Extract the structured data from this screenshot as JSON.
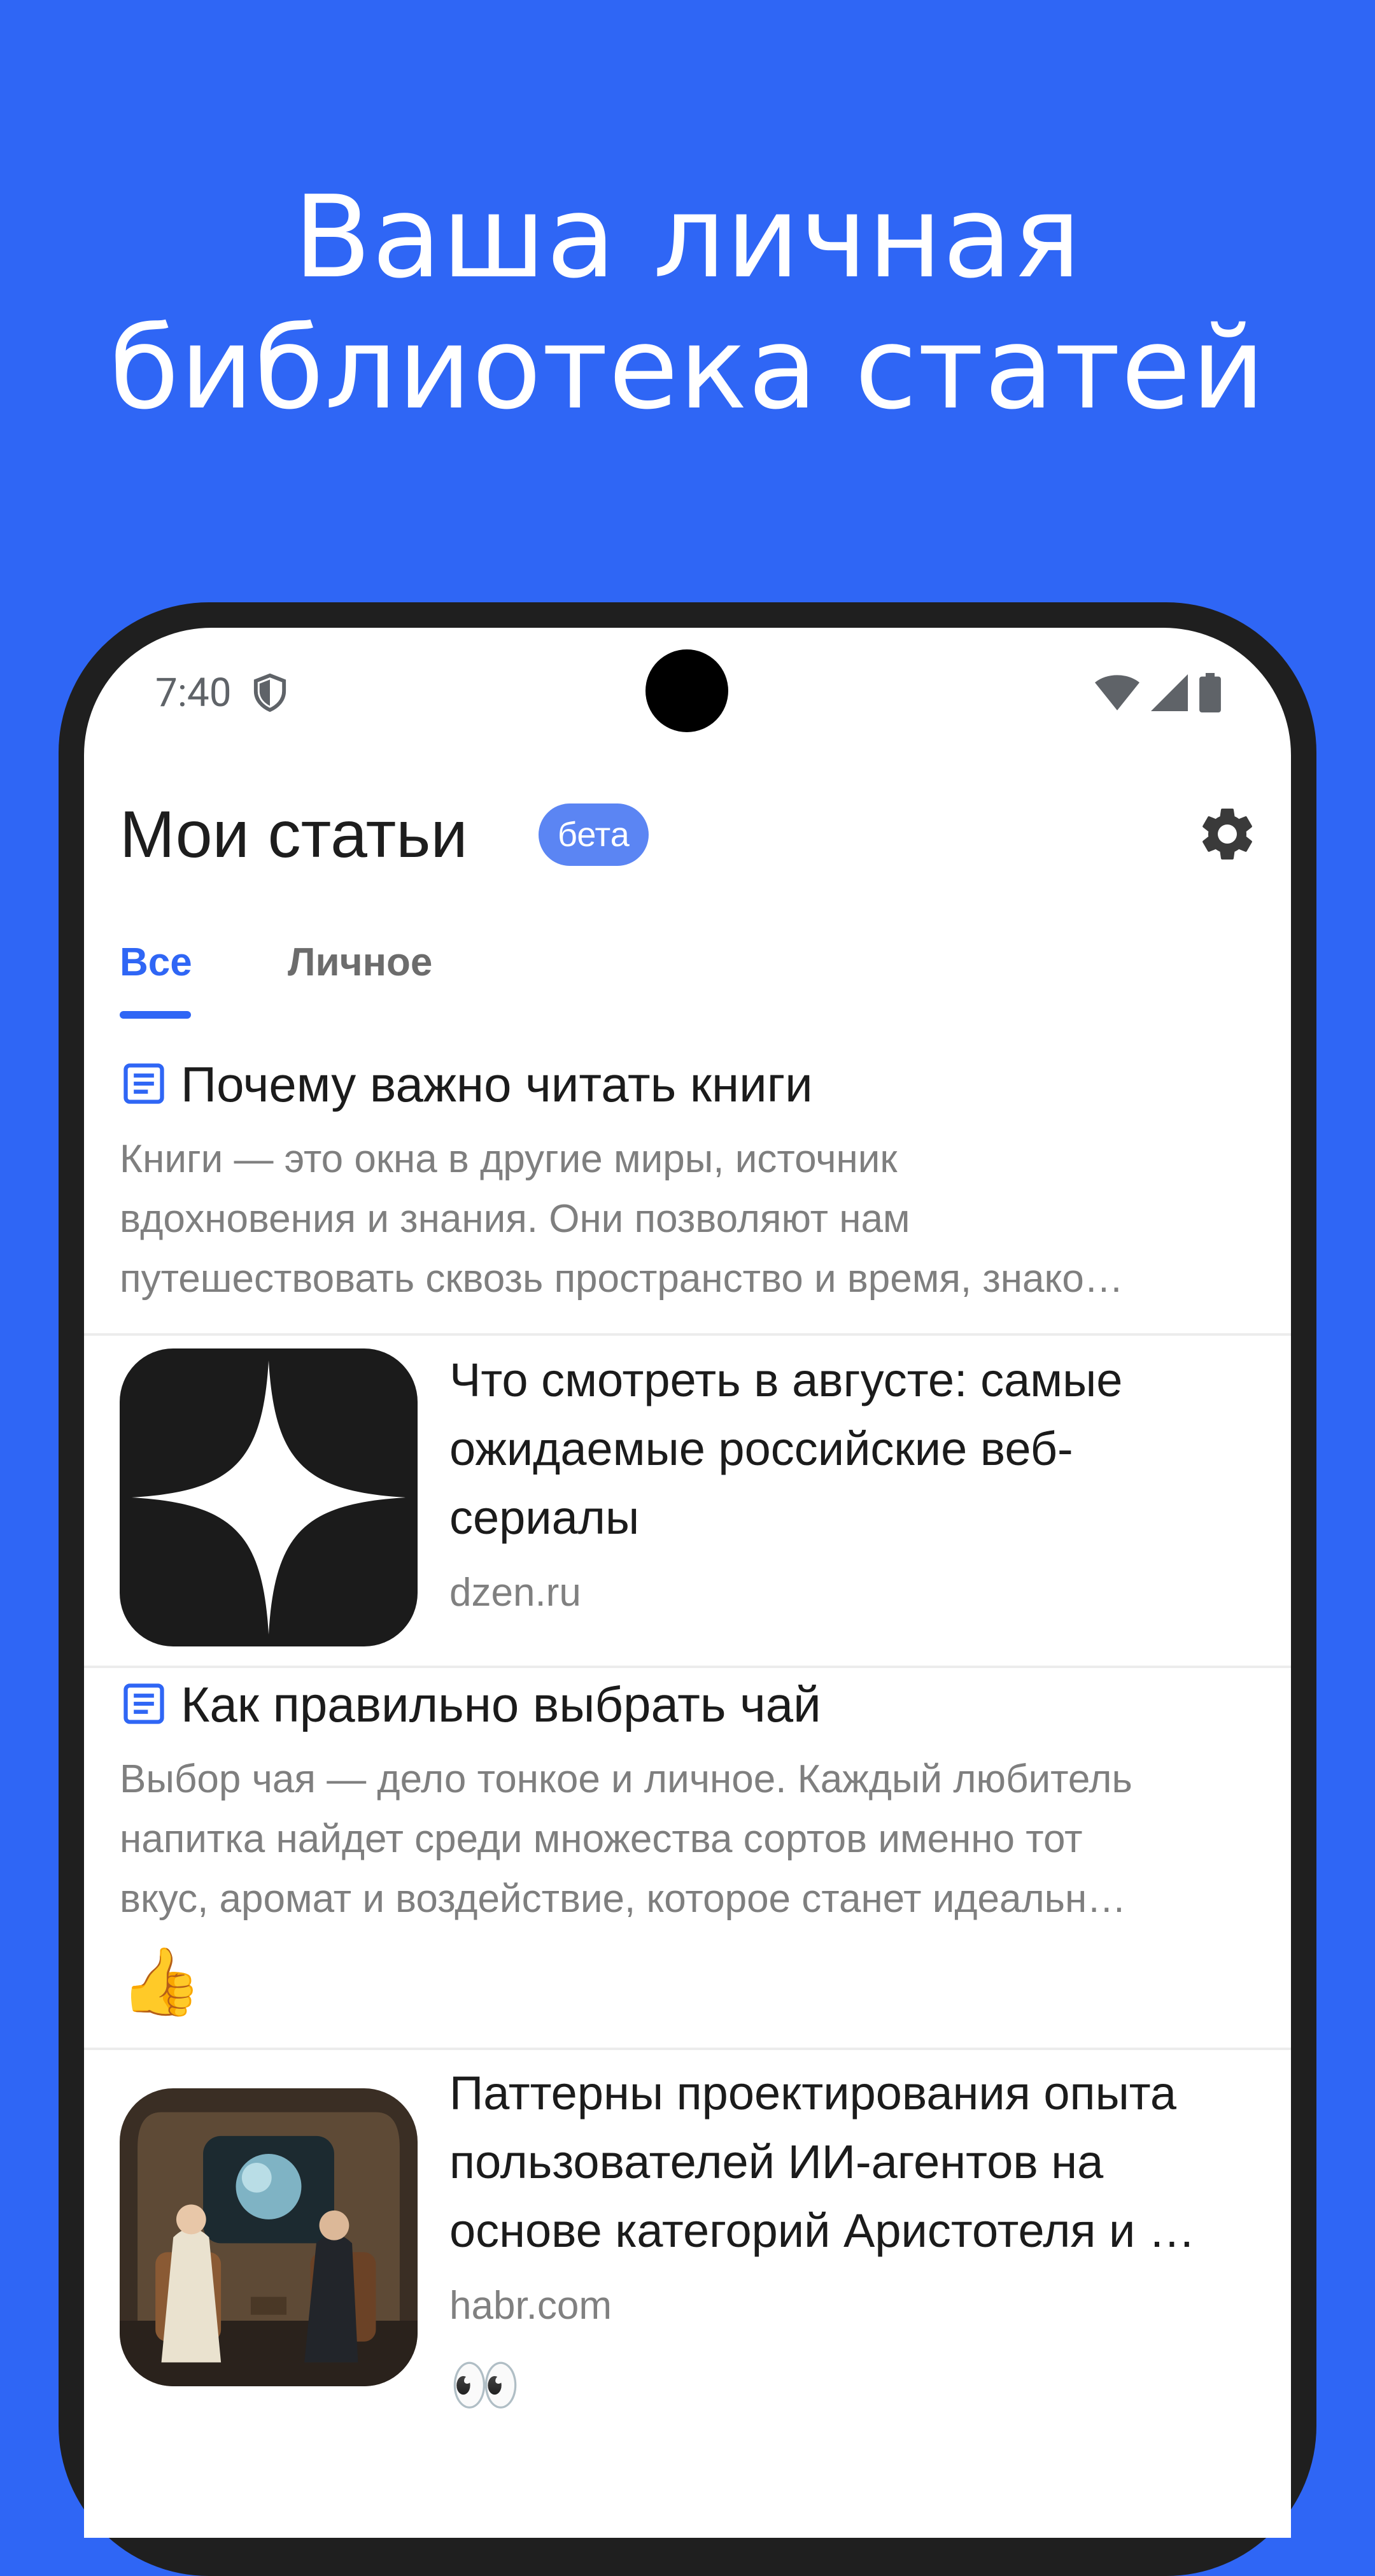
{
  "hero": {
    "line1": "Ваша личная",
    "line2": "библиотека статей"
  },
  "status_bar": {
    "time": "7:40"
  },
  "header": {
    "title": "Мои статьи",
    "badge": "бета"
  },
  "tabs": [
    {
      "label": "Все",
      "active": true
    },
    {
      "label": "Личное",
      "active": false
    }
  ],
  "articles": [
    {
      "type": "note",
      "title": "Почему важно читать книги",
      "excerpt_lines": [
        "Книги — это окна в другие миры, источник",
        "вдохновения и знания. Они позволяют нам",
        "путешествовать сквозь пространство и время, знако…"
      ]
    },
    {
      "type": "link",
      "title_lines": [
        "Что смотреть в августе: самые",
        "ожидаемые российские веб-",
        "сериалы"
      ],
      "source": "dzen.ru",
      "thumbnail": "dzen-logo"
    },
    {
      "type": "note",
      "title": "Как правильно выбрать чай",
      "excerpt_lines": [
        "Выбор чая — дело тонкое и личное. Каждый любитель",
        "напитка найдет среди множества сортов именно тот",
        "вкус, аромат и воздействие, которое станет идеальн…"
      ],
      "reaction": "👍"
    },
    {
      "type": "link",
      "title_lines": [
        "Паттерны проектирования опыта",
        "пользователей ИИ-агентов на",
        "основе категорий Аристотеля и …"
      ],
      "source": "habr.com",
      "thumbnail": "illustration-two-men-spaceship",
      "reaction": "👀"
    }
  ],
  "colors": {
    "brand_blue": "#2f66f5",
    "badge_blue": "#5b85f3",
    "phone_frame": "#1f1f1f"
  }
}
